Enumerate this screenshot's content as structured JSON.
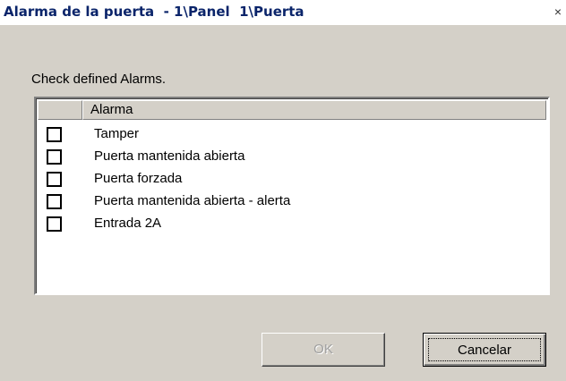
{
  "window": {
    "title": "Alarma de la puerta  - 1\\Panel  1\\Puerta",
    "close_glyph": "×"
  },
  "instruction": "Check defined Alarms.",
  "list": {
    "columns": [
      "",
      "Alarma"
    ],
    "items": [
      {
        "label": "Tamper",
        "checked": false
      },
      {
        "label": "Puerta mantenida abierta",
        "checked": false
      },
      {
        "label": "Puerta forzada",
        "checked": false
      },
      {
        "label": "Puerta mantenida abierta - alerta",
        "checked": false
      },
      {
        "label": "Entrada 2A",
        "checked": false
      }
    ]
  },
  "buttons": {
    "ok_label": "OK",
    "cancel_label": "Cancelar"
  }
}
